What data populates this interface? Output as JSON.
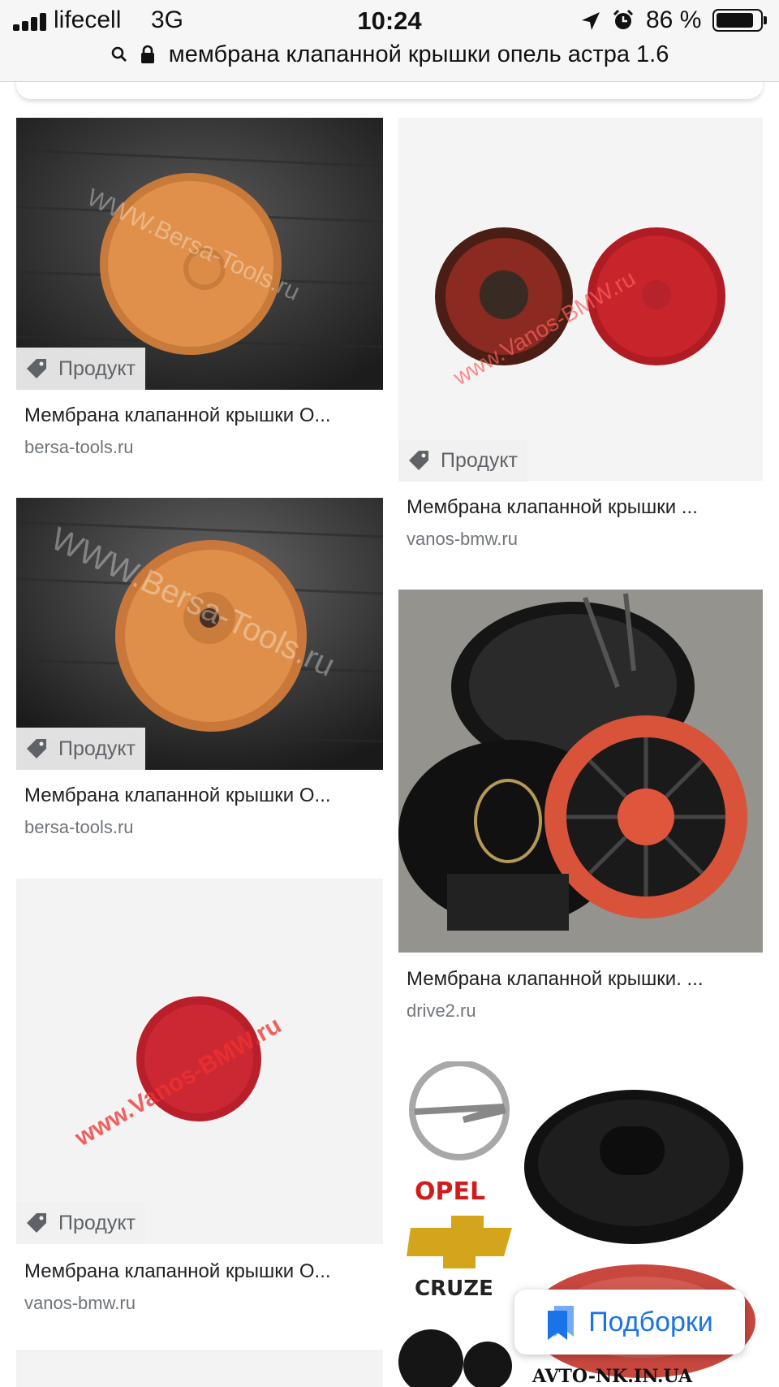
{
  "status_bar": {
    "carrier": "lifecell",
    "network": "3G",
    "time": "10:24",
    "battery": "86 %",
    "battery_level": 0.86
  },
  "url_bar": {
    "query": "мембрана клапанной крышки опель астра 1.6"
  },
  "results": [
    {
      "badge": "Продукт",
      "title": "Мембрана клапанной крышки О...",
      "source": "bersa-tools.ru",
      "watermark": "WWW.Bersa-Tools.ru"
    },
    {
      "badge": "Продукт",
      "title": "Мембрана клапанной крышки ...",
      "source": "vanos-bmw.ru",
      "watermark": "www.Vanos-BMW.ru"
    },
    {
      "badge": "Продукт",
      "title": "Мембрана клапанной крышки О...",
      "source": "bersa-tools.ru",
      "watermark": "WWW.Bersa-Tools.ru"
    },
    {
      "title": "Мембрана клапанной крышки. ...",
      "source": "drive2.ru"
    },
    {
      "badge": "Продукт",
      "title": "Мембрана клапанной крышки О...",
      "source": "vanos-bmw.ru",
      "watermark": "www.Vanos-BMW.ru"
    },
    {
      "image_text": [
        "OPEL",
        "CRUZE",
        "AVTO-NK.IN.UA"
      ]
    }
  ],
  "collections_button": {
    "label": "Подборки",
    "icon": "bookmarks-icon",
    "color": "#1a73e8"
  }
}
